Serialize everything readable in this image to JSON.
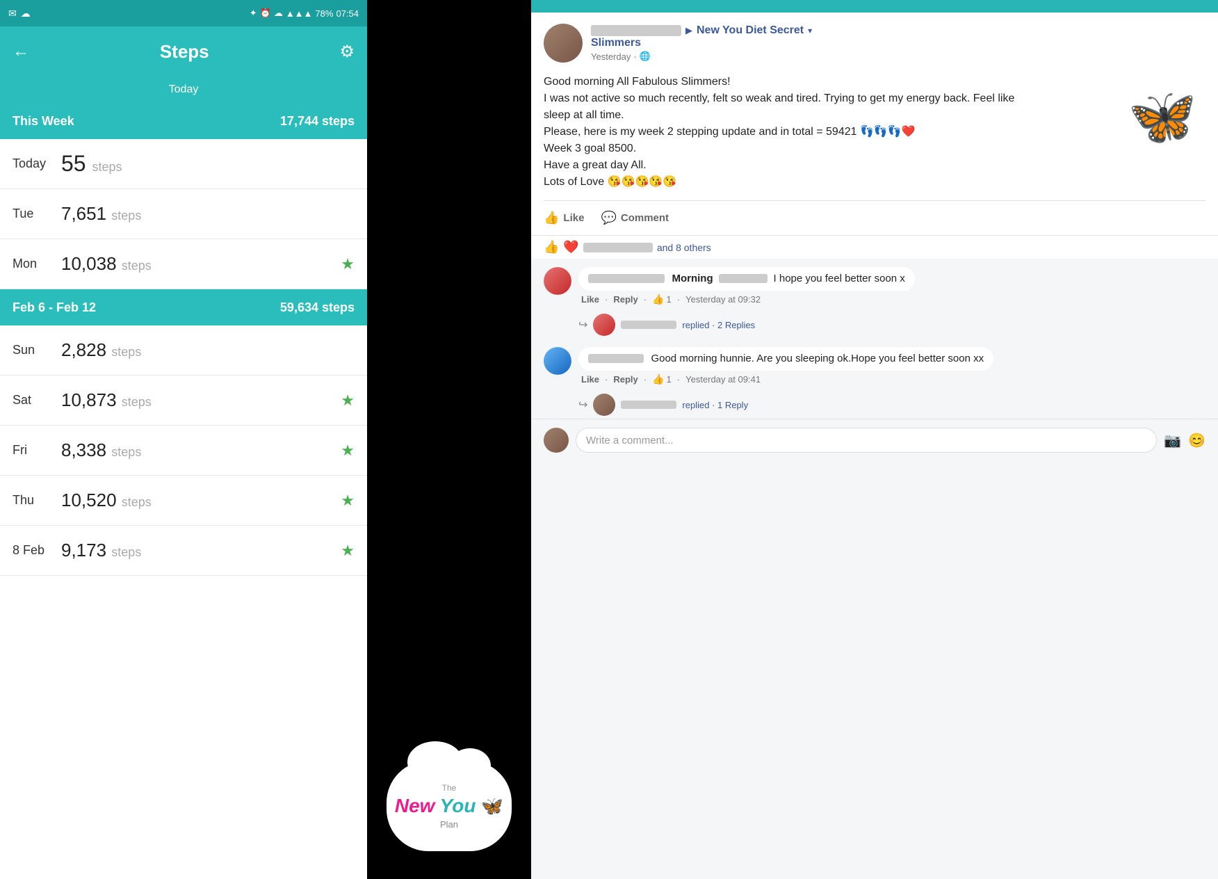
{
  "statusBar": {
    "time": "07:54",
    "battery": "78%",
    "icons": "✦ ⏰ ☁ ▲ ∎"
  },
  "appHeader": {
    "title": "Steps",
    "backLabel": "←",
    "settingsLabel": "⚙"
  },
  "todayTab": {
    "label": "Today"
  },
  "thisWeek": {
    "label": "This Week",
    "steps": "17,744 steps"
  },
  "stepRows": [
    {
      "day": "Today",
      "count": "55",
      "unit": "steps",
      "star": false,
      "today": true
    },
    {
      "day": "Tue",
      "count": "7,651",
      "unit": "steps",
      "star": false,
      "today": false
    },
    {
      "day": "Mon",
      "count": "10,038",
      "unit": "steps",
      "star": true,
      "today": false
    }
  ],
  "weekRange": {
    "label": "Feb 6 - Feb 12",
    "steps": "59,634 steps"
  },
  "weekRows": [
    {
      "day": "Sun",
      "count": "2,828",
      "unit": "steps",
      "star": false
    },
    {
      "day": "Sat",
      "count": "10,873",
      "unit": "steps",
      "star": true
    },
    {
      "day": "Fri",
      "count": "8,338",
      "unit": "steps",
      "star": true
    },
    {
      "day": "Thu",
      "count": "10,520",
      "unit": "steps",
      "star": true
    },
    {
      "day": "8 Feb",
      "count": "9,173",
      "unit": "steps",
      "star": true
    }
  ],
  "logo": {
    "the": "The",
    "new": "New",
    "you": "You",
    "butterfly": "🦋",
    "plan": "Plan"
  },
  "facebook": {
    "groupName": "New You Diet Secret",
    "slimmers": "Slimmers",
    "postTime": "Yesterday · 🌐",
    "postBody": "Good morning All Fabulous Slimmers!\nI was not active so much recently, felt so weak and tired. Trying to get my energy back. Feel like sleep at all time.\nPlease, here is my week 2 stepping update and in total = 59421 👣👣👣❤️\nWeek 3 goal 8500.\nHave a great day All.\nLots of Love 😘😘😘😘😘",
    "likeLabel": "Like",
    "commentLabel": "Comment",
    "reactionsText": "and 8 others",
    "comments": [
      {
        "nameBlurred": true,
        "text": "Morning [blurred] I hope you feel better soon x",
        "time": "Yesterday at 09:32",
        "likes": "1",
        "replyLabel": "Reply",
        "likeLabel": "Like",
        "replied": "replied · 2 Replies"
      },
      {
        "nameBlurred": true,
        "text": "Good morning hunnie. Are you sleeping ok.Hope you feel better soon xx",
        "time": "Yesterday at 09:41",
        "likes": "1",
        "replyLabel": "Reply",
        "likeLabel": "Like",
        "replied": "replied · 1 Reply"
      }
    ],
    "commentPlaceholder": "Write a comment...",
    "morningWord": "Morning"
  }
}
